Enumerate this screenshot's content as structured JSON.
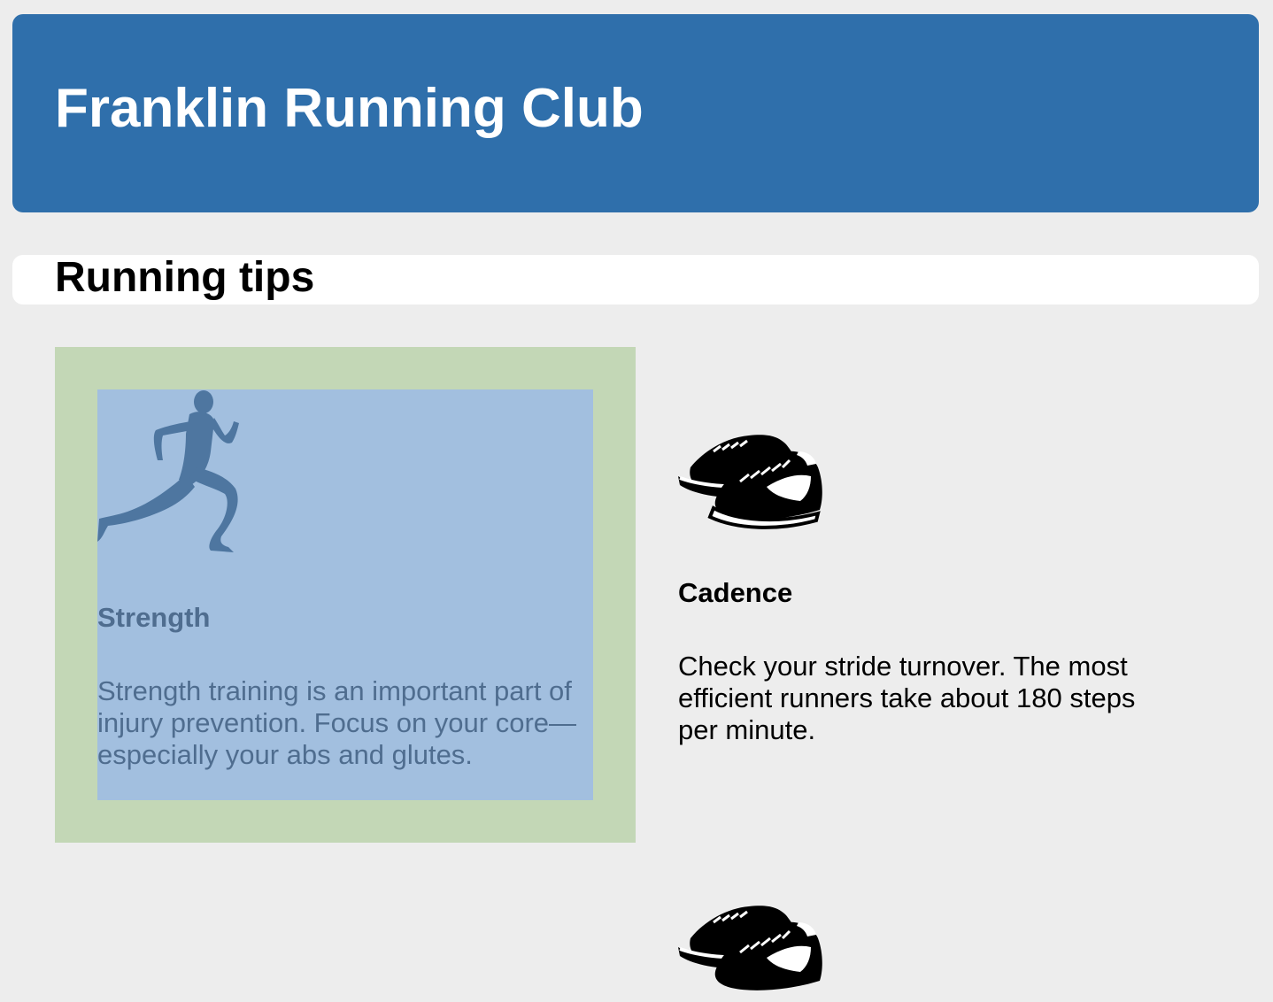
{
  "header": {
    "title": "Franklin Running Club",
    "background_color": "#2f6fab"
  },
  "section": {
    "title": "Running tips"
  },
  "tips": [
    {
      "icon": "runner-silhouette-icon",
      "title": "Strength",
      "body": "Strength training is an important part of injury prevention. Focus on your core—especially your abs and glutes.",
      "highlight_outer_color": "#c3d7b6",
      "highlight_inner_color": "#a2bfdf"
    },
    {
      "icon": "running-shoes-icon",
      "title": "Cadence",
      "body": "Check your stride turnover. The most efficient runners take about 180 steps per minute."
    },
    {
      "icon": "running-shoes-icon"
    }
  ]
}
